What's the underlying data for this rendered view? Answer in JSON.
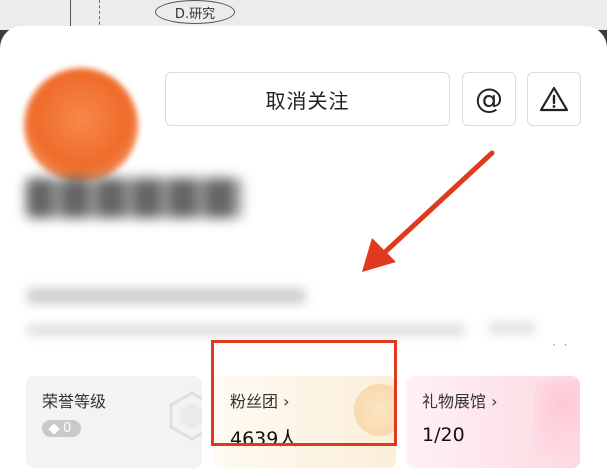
{
  "background_strip": {
    "label": "D.研究"
  },
  "profile": {
    "unfollow_label": "取消关注",
    "mention_icon": "at-icon",
    "report_icon": "warning-triangle-icon"
  },
  "stats": [
    {
      "title": "荣誉等级",
      "badge_value": "0"
    },
    {
      "title": "粉丝团 ›",
      "value": "4639人"
    },
    {
      "title": "礼物展馆 ›",
      "value": "1/20"
    }
  ],
  "more_indicator": "· ·",
  "colors": {
    "annotation_red": "#e03a1e",
    "avatar_orange": "#f06b2a"
  }
}
